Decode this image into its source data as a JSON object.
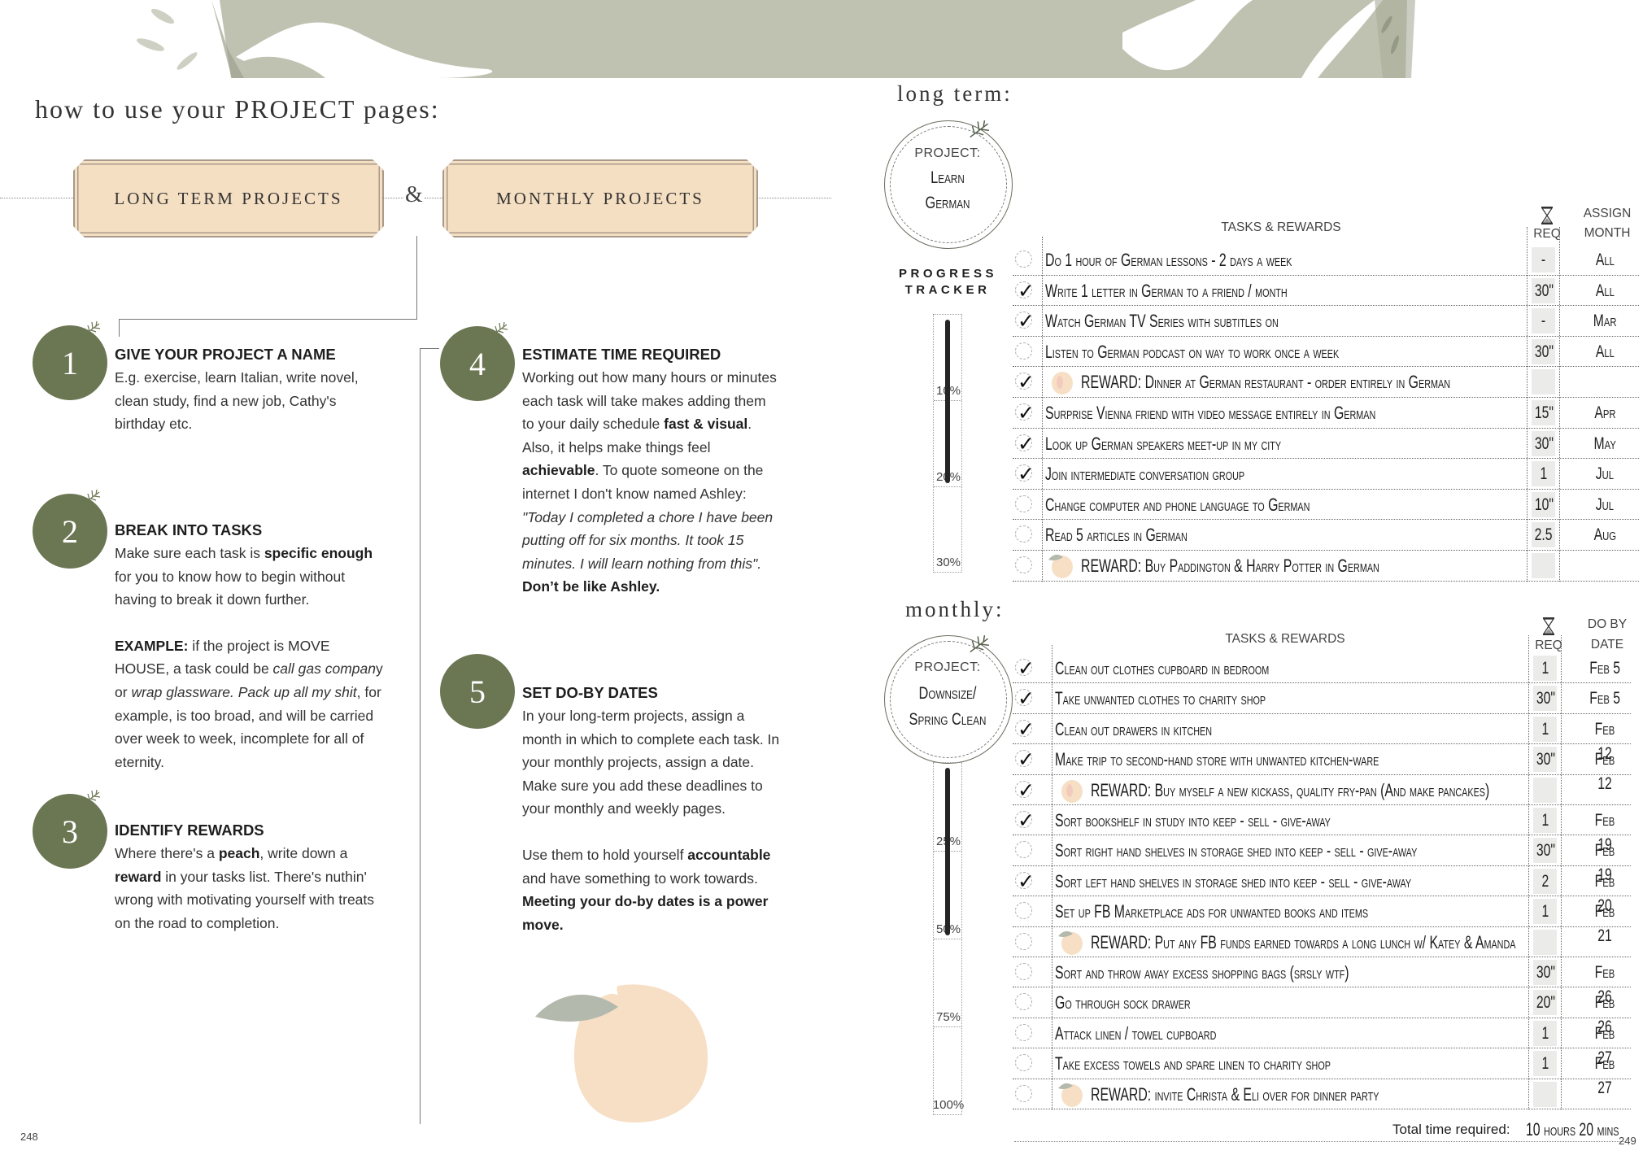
{
  "colors": {
    "banner": "#bfc2b0",
    "step_circle": "#6b7653",
    "label_box": "#f5dfc2",
    "peach": "#f7dfc6",
    "leaf": "#b3b9ad",
    "req_cell": "#ebebea"
  },
  "left_page": {
    "title": "how to use your PROJECT pages:",
    "boxes": {
      "long_term": "LONG TERM PROJECTS",
      "ampersand": "&",
      "monthly": "MONTHLY PROJECTS"
    },
    "steps": [
      {
        "number": "1",
        "heading": "GIVE YOUR PROJECT A NAME",
        "body": "E.g. exercise, learn Italian, write novel, clean study, find a new job, Cathy's birthday etc."
      },
      {
        "number": "2",
        "heading": "BREAK INTO TASKS",
        "body_pre": "Make sure each task is ",
        "body_bold": "specific enough",
        "body_post": " for you to know how to begin without having to break it down further.",
        "example_label": "EXAMPLE:",
        "example_1": " if the project is MOVE HOUSE, a task could be ",
        "example_italic_1": "call gas compan",
        "example_2": "y or ",
        "example_italic_2": "wrap glassware. Pack up all my shit",
        "example_3": ", for example, is too broad, and will be carried over week to week, incomplete for all of eternity."
      },
      {
        "number": "3",
        "heading": "IDENTIFY REWARDS",
        "body_1": "Where there's a ",
        "body_bold_1": "peach",
        "body_2": ", write down a ",
        "body_bold_2": "reward",
        "body_3": " in your tasks list. There's nuthin' wrong with motivating yourself with treats on the road to completion."
      },
      {
        "number": "4",
        "heading": "ESTIMATE TIME REQUIRED",
        "body_1": "Working out how many hours or minutes each task will take makes adding them to your daily schedule ",
        "body_bold_1": "fast & visual",
        "body_2": ". Also, it helps make things feel ",
        "body_bold_2": "achievable",
        "body_3": ". To quote someone on the internet I don't know named Ashley: ",
        "quote": "\"Today I completed a chore I have been putting off for six months. It took 15 minutes. I will learn nothing from this\".",
        "closing": "Don’t be like Ashley."
      },
      {
        "number": "5",
        "heading": "SET DO-BY DATES",
        "body": "In your long-term projects, assign a month in which to complete each task. In your monthly projects, assign a date. Make sure you add these deadlines to your monthly and weekly pages.",
        "body2_1": "Use them to hold yourself ",
        "body2_bold": "accountable",
        "body2_2": " and have something to work towards.",
        "closing": "Meeting your do-by dates is a power move."
      }
    ],
    "page_number": "248"
  },
  "right_page": {
    "long_term": {
      "section_title": "long term:",
      "project_label": "PROJECT:",
      "project_name_line1": "Learn",
      "project_name_line2": "German",
      "tracker_title_1": "PROGRESS",
      "tracker_title_2": "TRACKER",
      "tracker_ticks": [
        "10%",
        "20%",
        "30%"
      ],
      "tracker_progress_percent": 20,
      "headers": {
        "tasks": "TASKS & REWARDS",
        "req": "REQ",
        "month_1": "ASSIGN",
        "month_2": "MONTH"
      },
      "rows": [
        {
          "done": false,
          "reward": false,
          "task": "Do 1 hour of German lessons - 2 days a week",
          "req": "-",
          "when": "All"
        },
        {
          "done": true,
          "reward": false,
          "task": "Write 1 letter in German to a friend / month",
          "req": "30\"",
          "when": "All"
        },
        {
          "done": true,
          "reward": false,
          "task": "Watch German TV Series with subtitles on",
          "req": "-",
          "when": "Mar"
        },
        {
          "done": false,
          "reward": false,
          "task": "Listen to German podcast on way to work once a week",
          "req": "30\"",
          "when": "All"
        },
        {
          "done": true,
          "reward": true,
          "task": "REWARD: Dinner at German restaurant - order entirely in German",
          "req": "",
          "when": ""
        },
        {
          "done": true,
          "reward": false,
          "task": "Surprise Vienna friend with video message entirely in German",
          "req": "15\"",
          "when": "Apr"
        },
        {
          "done": true,
          "reward": false,
          "task": "Look up German speakers meet-up in my city",
          "req": "30\"",
          "when": "May"
        },
        {
          "done": true,
          "reward": false,
          "task": "Join intermediate conversation group",
          "req": "1",
          "when": "Jul"
        },
        {
          "done": false,
          "reward": false,
          "task": "Change computer and phone language to German",
          "req": "10\"",
          "when": "Jul"
        },
        {
          "done": false,
          "reward": false,
          "task": "Read 5 articles in German",
          "req": "2.5",
          "when": "Aug"
        },
        {
          "done": false,
          "reward": true,
          "task": "REWARD: Buy Paddington & Harry Potter in German",
          "req": "",
          "when": ""
        }
      ]
    },
    "monthly": {
      "section_title": "monthly:",
      "project_label": "PROJECT:",
      "project_name_line1": "Downsize/",
      "project_name_line2": "Spring Clean",
      "tracker_ticks": [
        "25%",
        "50%",
        "75%",
        "100%"
      ],
      "tracker_progress_percent": 50,
      "headers": {
        "tasks": "TASKS & REWARDS",
        "req": "REQ",
        "month_1": "DO BY",
        "month_2": "DATE"
      },
      "rows": [
        {
          "done": true,
          "reward": false,
          "task": "Clean out clothes cupboard in bedroom",
          "req": "1",
          "when": "Feb 5"
        },
        {
          "done": true,
          "reward": false,
          "task": "Take unwanted clothes to charity shop",
          "req": "30\"",
          "when": "Feb 5"
        },
        {
          "done": true,
          "reward": false,
          "task": "Clean out drawers in kitchen",
          "req": "1",
          "when": "Feb 12"
        },
        {
          "done": true,
          "reward": false,
          "task": "Make trip to second-hand store with unwanted kitchen-ware",
          "req": "30\"",
          "when": "Feb 12"
        },
        {
          "done": true,
          "reward": true,
          "task": "REWARD: Buy myself a new kickass, quality fry-pan (And make pancakes)",
          "req": "",
          "when": ""
        },
        {
          "done": true,
          "reward": false,
          "task": "Sort bookshelf in study into keep - sell - give-away",
          "req": "1",
          "when": "Feb 19"
        },
        {
          "done": false,
          "reward": false,
          "task": "Sort right hand shelves in storage shed into keep - sell - give-away",
          "req": "30\"",
          "when": "Feb 19"
        },
        {
          "done": true,
          "reward": false,
          "task": "Sort left hand shelves in storage shed into keep - sell - give-away",
          "req": "2",
          "when": "Feb 20"
        },
        {
          "done": false,
          "reward": false,
          "task": "Set up FB Marketplace ads for unwanted books and items",
          "req": "1",
          "when": "Feb 21"
        },
        {
          "done": false,
          "reward": true,
          "task": "REWARD: Put any FB funds earned towards a long lunch w/ Katey & Amanda",
          "req": "",
          "when": ""
        },
        {
          "done": false,
          "reward": false,
          "task": "Sort and throw away excess shopping bags (srsly wtf)",
          "req": "30\"",
          "when": "Feb 26"
        },
        {
          "done": false,
          "reward": false,
          "task": "Go through sock drawer",
          "req": "20\"",
          "when": "Feb 26"
        },
        {
          "done": false,
          "reward": false,
          "task": "Attack linen / towel cupboard",
          "req": "1",
          "when": "Feb 27"
        },
        {
          "done": false,
          "reward": false,
          "task": "Take excess towels and spare linen to charity shop",
          "req": "1",
          "when": "Feb 27"
        },
        {
          "done": false,
          "reward": true,
          "task": "REWARD: invite Christa & Eli over for dinner party",
          "req": "",
          "when": ""
        }
      ],
      "total_label": "Total time required:",
      "total_value": "10 hours 20 mins"
    },
    "page_number": "249"
  }
}
